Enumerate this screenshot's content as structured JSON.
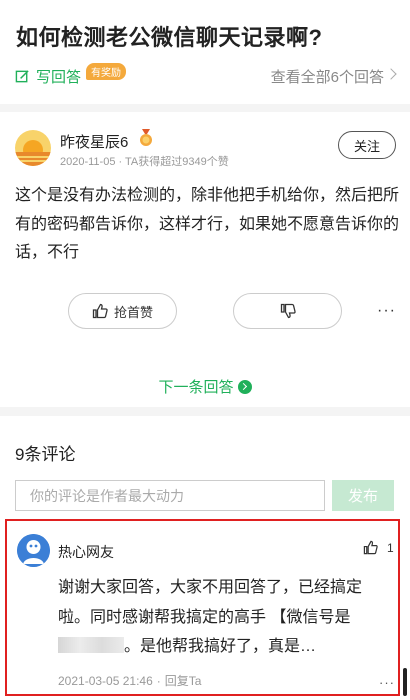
{
  "question": {
    "title": "如何检测老公微信聊天记录啊?",
    "write_answer_label": "写回答",
    "reward_badge": "有奖励",
    "view_all_label": "查看全部6个回答"
  },
  "answer": {
    "author_name": "昨夜星辰6",
    "author_meta": "2020-11-05 · TA获得超过9349个赞",
    "follow_label": "关注",
    "text": "这个是没有办法检测的，除非他把手机给你，然后把所有的密码都告诉你，这样才行，如果她不愿意告诉你的话，不行",
    "like_label": "抢首赞",
    "more_label": "···",
    "next_answer_label": "下一条回答"
  },
  "comments": {
    "count_label": "9条评论",
    "input_placeholder": "你的评论是作者最大动力",
    "publish_label": "发布",
    "items": [
      {
        "name": "热心网友",
        "likes": "1",
        "text_part1": "谢谢大家回答，大家不用回答了，已经搞定啦。同时感谢帮我搞定的高手 【微信号是",
        "text_part2": "。是他帮我搞好了，真是…",
        "date": "2021-03-05 21:46",
        "reply_label": "回复Ta",
        "more_label": "···"
      }
    ]
  },
  "colors": {
    "accent_green": "#20b05a",
    "reward_orange": "#f4a93c",
    "highlight_red": "#e02020"
  }
}
